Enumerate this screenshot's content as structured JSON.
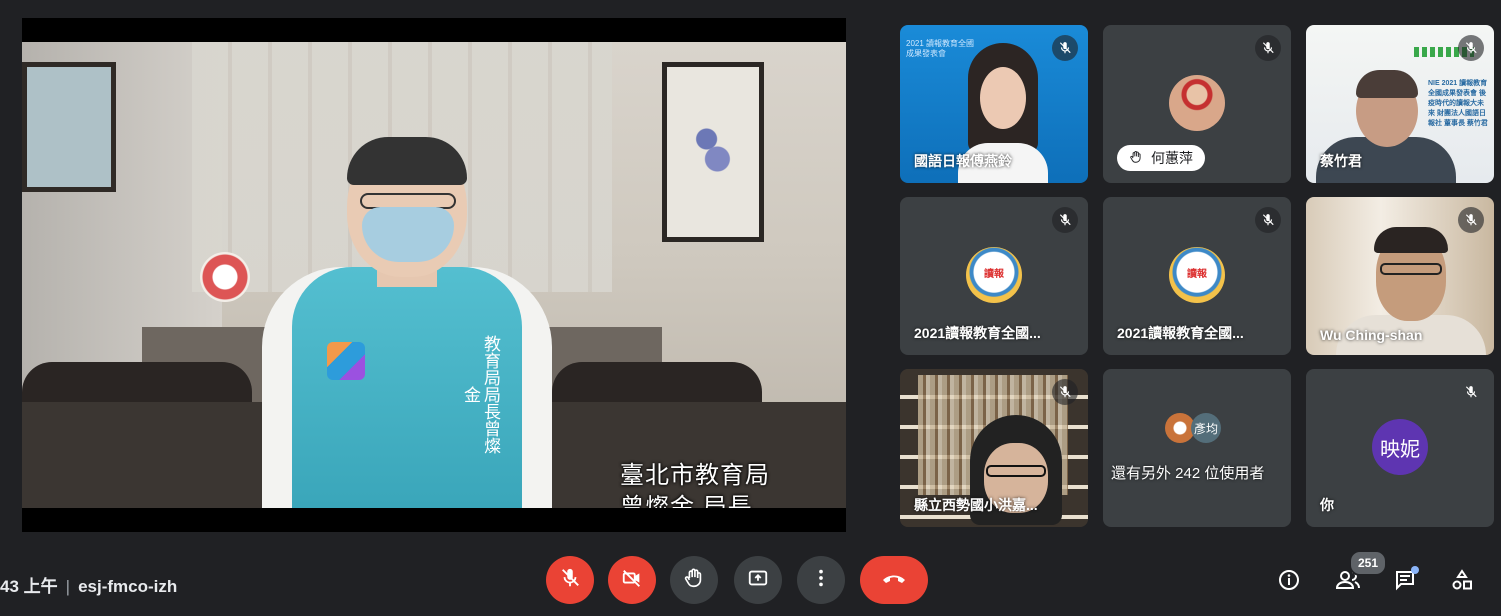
{
  "main_speaker": {
    "vest_text": "教育局局長曾燦金",
    "subtitle_line1": "臺北市教育局",
    "subtitle_line2": "曾燦金 局長"
  },
  "tiles": [
    {
      "name": "國語日報傅燕鈴",
      "muted": true,
      "deco": "2021 讀報教育全國成果發表會"
    },
    {
      "name": "何蕙萍",
      "hand_raised": true,
      "muted": true
    },
    {
      "name": "蔡竹君",
      "muted": true,
      "logo_text": "NIE 2021 讀報教育全國成果發表會 後疫時代的讀報大未來 財團法人國語日報社 董事長 蔡竹君"
    },
    {
      "name": "2021讀報教育全國...",
      "muted": true
    },
    {
      "name": "2021讀報教育全國...",
      "muted": true
    },
    {
      "name": "Wu Ching-shan",
      "muted": true
    },
    {
      "name": "縣立西勢國小洪嘉...",
      "muted": true
    },
    {
      "name": "還有另外 242 位使用者",
      "avatar_label": "彥均"
    },
    {
      "name": "你",
      "avatar_letter": "映妮",
      "muted": true
    }
  ],
  "bottom_bar": {
    "time": "43 上午",
    "meeting_code": "esj-fmco-izh",
    "participant_count": "251"
  },
  "colors": {
    "background": "#202124",
    "tile": "#3c4043",
    "end_call": "#ea4335",
    "avatar": "#5e35b1"
  }
}
